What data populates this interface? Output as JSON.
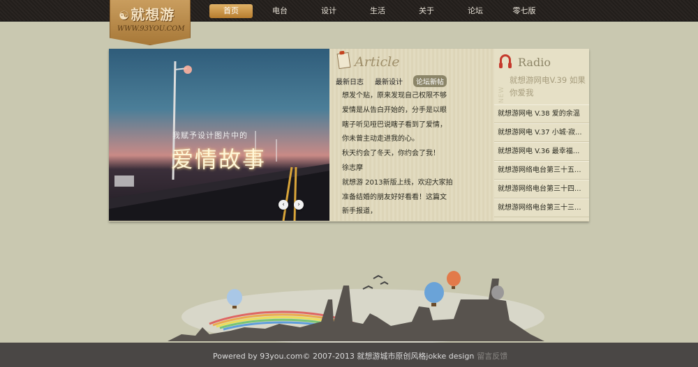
{
  "logo": {
    "brand": "就想游",
    "url": "WWW.93YOU.COM"
  },
  "nav": [
    {
      "label": "首页",
      "active": true
    },
    {
      "label": "电台"
    },
    {
      "label": "设计"
    },
    {
      "label": "生活"
    },
    {
      "label": "关于"
    },
    {
      "label": "论坛"
    },
    {
      "label": "零七版"
    }
  ],
  "slider": {
    "caption_top": "我赋予设计图片中的",
    "caption_main": "爱情故事",
    "prev": "‹",
    "next": "›"
  },
  "article": {
    "title": "Article",
    "tabs": [
      "最新日志",
      "最新设计",
      "论坛新帖"
    ],
    "active_tab": "论坛新帖",
    "items": [
      "想发个贴，原来发现自己权限不够",
      "爱情是从告白开始的，分手是以眼",
      "瞎子听见哑巴说瞎子看到了爱情，",
      "你未曾主动走进我的心。",
      "秋天约会了冬天，你约会了我！",
      "徐志摩",
      "就想游 2013新版上线，欢迎大家拍",
      "准备结婚的朋友好好看看！这篇文",
      "新手报道，"
    ]
  },
  "radio": {
    "title": "Radio",
    "badge": "NEW",
    "feature": "就想游网电V.39 如果你爱我",
    "items": [
      "就想游网电 V.38 爱的余温",
      "就想游网电 V.37 小城·寂...",
      "就想游网电 V.36 最幸福...",
      "就想游网络电台第三十五...",
      "就想游网络电台第三十四...",
      "就想游网络电台第三十三..."
    ]
  },
  "footer": {
    "text": "Powered by 93you.com© 2007-2013 就想游城市原创风格jokke design",
    "link": "留言反馈"
  },
  "colors": {
    "background": "#c9c8b0",
    "topbar": "#2a2522",
    "accent": "#c99d5e",
    "footer": "#4a4745"
  }
}
